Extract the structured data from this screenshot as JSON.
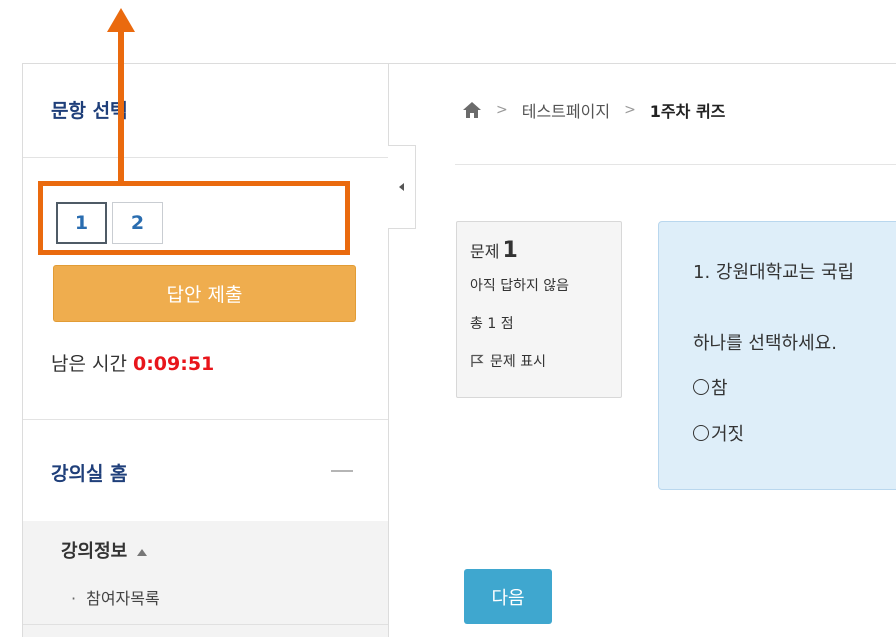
{
  "sidebar": {
    "title": "문항 선택",
    "questions": [
      "1",
      "2"
    ],
    "current_question": "1",
    "submit_label": "답안 제출",
    "timer_label": "남은 시간",
    "timer_value": "0:09:51",
    "course_home": "강의실 홈",
    "section_title": "강의정보",
    "section_item": "참여자목록",
    "bullet": "·"
  },
  "breadcrumb": {
    "items": [
      "테스트페이지",
      "1주차 퀴즈"
    ],
    "separator": ">"
  },
  "question": {
    "label": "문제",
    "number": "1",
    "status": "아직 답하지 않음",
    "points": "총 1 점",
    "flag_label": "문제 표시",
    "text": "1. 강원대학교는 국립",
    "prompt": "하나를 선택하세요.",
    "options": [
      "참",
      "거짓"
    ]
  },
  "navigation": {
    "next_label": "다음"
  },
  "colors": {
    "annotation": "#ea6a0e",
    "submit": "#efad4e",
    "next": "#3fa7cf",
    "timer": "#e8151b",
    "question_bg": "#deeef9"
  }
}
